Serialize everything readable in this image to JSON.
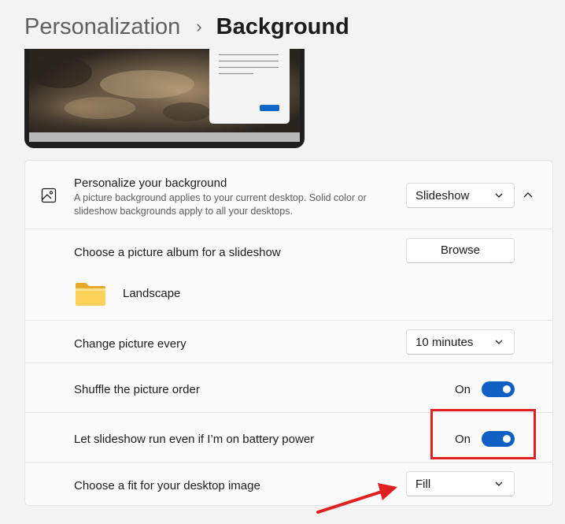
{
  "breadcrumb": {
    "parent": "Personalization",
    "separator": "›",
    "current": "Background"
  },
  "personalize": {
    "title": "Personalize your background",
    "description": "A picture background applies to your current desktop. Solid color or slideshow backgrounds apply to all your desktops.",
    "selected": "Slideshow"
  },
  "album": {
    "label": "Choose a picture album for a slideshow",
    "browse": "Browse",
    "folder": "Landscape"
  },
  "interval": {
    "label": "Change picture every",
    "selected": "10 minutes"
  },
  "shuffle": {
    "label": "Shuffle the picture order",
    "state": "On"
  },
  "battery": {
    "label": "Let slideshow run even if I’m on battery power",
    "state": "On"
  },
  "fit": {
    "label": "Choose a fit for your desktop image",
    "selected": "Fill"
  },
  "colors": {
    "accent": "#0f5fc4",
    "annotation": "#e02020"
  },
  "icons": {
    "background": "image-icon",
    "collapse": "chevron-up-icon",
    "dropdown": "chevron-down-icon",
    "folder": "folder-icon"
  }
}
